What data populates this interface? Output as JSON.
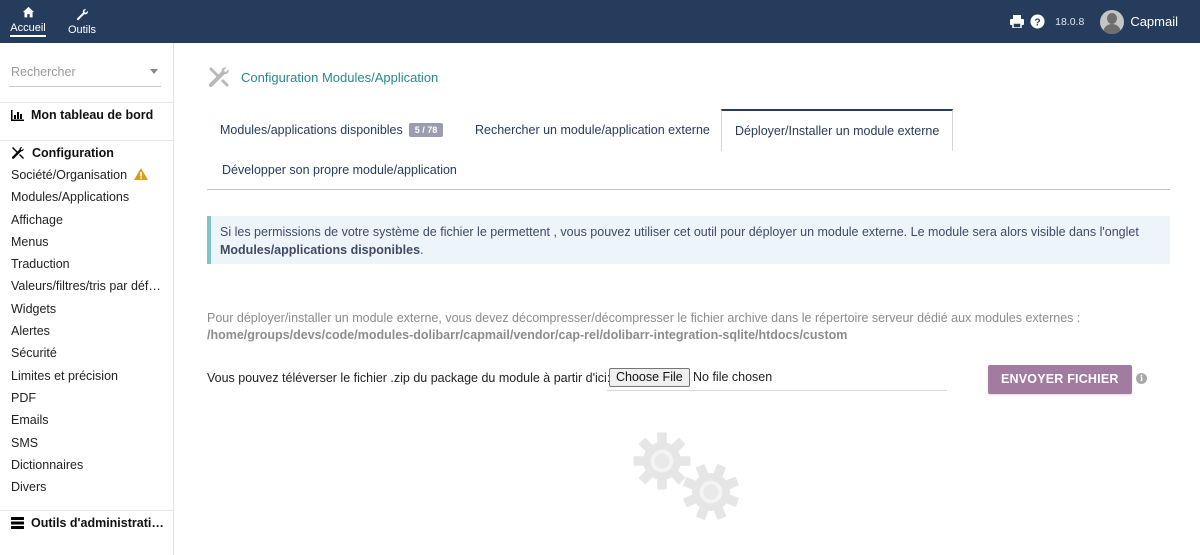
{
  "topbar": {
    "nav": [
      {
        "label": "Accueil",
        "icon": "home-icon"
      },
      {
        "label": "Outils",
        "icon": "wrench-icon"
      }
    ],
    "version": "18.0.8",
    "user": "Capmail"
  },
  "sidebar": {
    "search_placeholder": "Rechercher",
    "dashboard": "Mon tableau de bord",
    "config_head": "Configuration",
    "items": [
      "Société/Organisation",
      "Modules/Applications",
      "Affichage",
      "Menus",
      "Traduction",
      "Valeurs/filtres/tris par déf…",
      "Widgets",
      "Alertes",
      "Sécurité",
      "Limites et précision",
      "PDF",
      "Emails",
      "SMS",
      "Dictionnaires",
      "Divers"
    ],
    "admin_head": "Outils d'administrati…"
  },
  "main": {
    "title": "Configuration Modules/Application",
    "tabs": {
      "available": "Modules/applications disponibles",
      "available_badge": "5 / 78",
      "search_external": "Rechercher un module/application externe",
      "deploy": "Déployer/Installer un module externe",
      "develop": "Développer son propre module/application"
    },
    "info": {
      "text": "Si les permissions de votre système de fichier le permettent , vous pouvez utiliser cet outil pour déployer un module externe. Le module sera alors visible dans l'onglet",
      "link": "Modules/applications disponibles",
      "end": "."
    },
    "desc": {
      "text": "Pour déployer/installer un module externe, vous devez décompresser/décompresser le fichier archive dans le répertoire serveur dédié aux modules externes :",
      "path": "/home/groups/devs/code/modules-dolibarr/capmail/vendor/cap-rel/dolibarr-integration-sqlite/htdocs/custom"
    },
    "upload": {
      "label": "Vous pouvez téléverser le fichier .zip du package du module à partir d'ici:",
      "choose": "Choose File",
      "status": "No file chosen",
      "send": "ENVOYER FICHIER"
    }
  },
  "colors": {
    "topbar": "#263c5c",
    "title": "#2a8a8a",
    "button": "#a27ba0",
    "warning": "#d4a017"
  }
}
